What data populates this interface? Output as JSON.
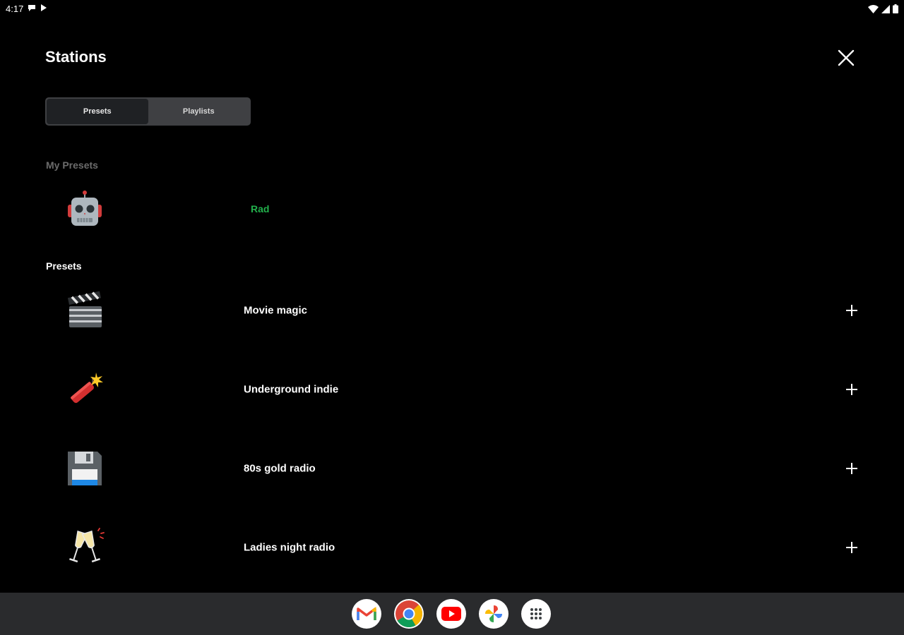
{
  "status": {
    "time": "4:17"
  },
  "header": {
    "title": "Stations"
  },
  "tabs": [
    {
      "label": "Presets",
      "active": true
    },
    {
      "label": "Playlists",
      "active": false
    }
  ],
  "my_presets": {
    "heading": "My Presets",
    "items": [
      {
        "icon": "robot-emoji",
        "name": "Rad",
        "color": "#22b14c"
      }
    ]
  },
  "presets": {
    "heading": "Presets",
    "items": [
      {
        "icon": "clapperboard-emoji",
        "name": "Movie magic"
      },
      {
        "icon": "firecracker-emoji",
        "name": "Underground indie"
      },
      {
        "icon": "floppy-disk-emoji",
        "name": "80s gold radio"
      },
      {
        "icon": "clinking-glasses-emoji",
        "name": "Ladies night radio"
      }
    ]
  },
  "dock": [
    "gmail",
    "chrome",
    "youtube",
    "photos",
    "app-drawer"
  ],
  "colors": {
    "background": "#000000",
    "accent_green": "#22b14c",
    "toggle_bg": "#3f4043",
    "taskbar": "#2a2b2d"
  }
}
